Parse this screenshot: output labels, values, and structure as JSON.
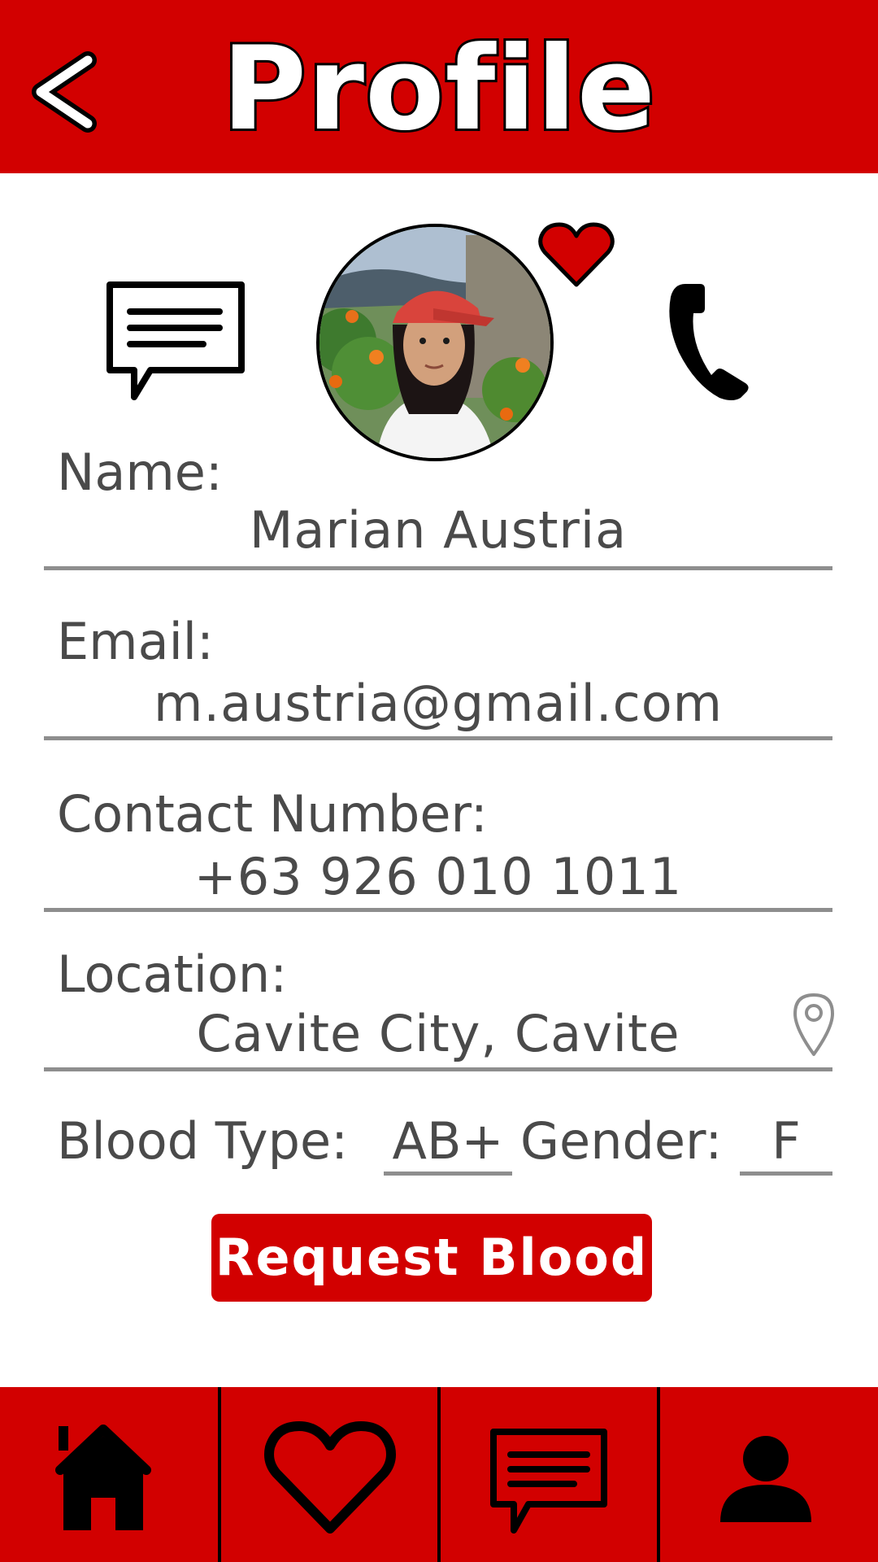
{
  "header": {
    "title": "Profile",
    "back_label": "<"
  },
  "colors": {
    "brand_red": "#d20000",
    "text_gray": "#4a4a4a",
    "line_gray": "#8e8e8e"
  },
  "actions": {
    "message_icon": "message-icon",
    "call_icon": "phone-icon",
    "favorite_icon": "heart-icon"
  },
  "profile": {
    "name_label": "Name:",
    "name": "Marian Austria",
    "email_label": "Email:",
    "email": "m.austria@gmail.com",
    "contact_label": "Contact Number:",
    "contact": "+63 926 010 1011",
    "location_label": "Location:",
    "location": "Cavite City, Cavite",
    "blood_type_label": "Blood Type:",
    "blood_type": "AB+",
    "gender_label": "Gender:",
    "gender": "F"
  },
  "request_button": {
    "label": "Request Blood"
  },
  "bottom_nav": {
    "items": [
      {
        "icon": "home-icon"
      },
      {
        "icon": "heart-icon"
      },
      {
        "icon": "message-icon"
      },
      {
        "icon": "user-icon"
      }
    ]
  }
}
